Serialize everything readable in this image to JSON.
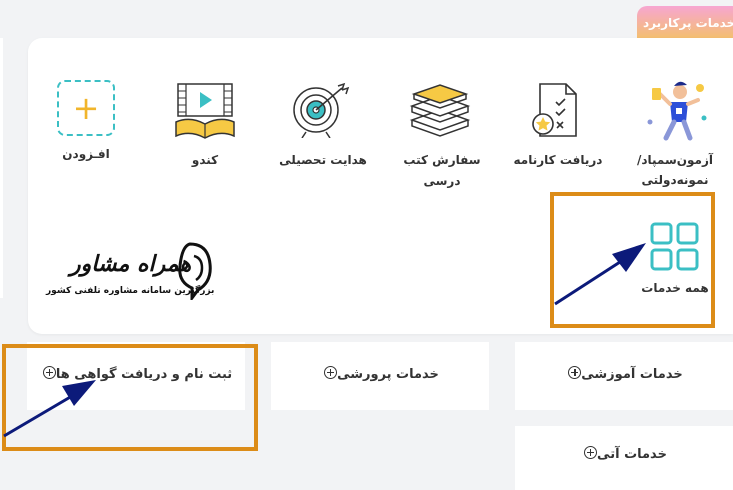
{
  "popular": {
    "badge": "خدمات پرکاربرد",
    "tiles": [
      {
        "label": "آزمون‌سمپاد/نمونه‌دولتی",
        "icon": "person-running-icon"
      },
      {
        "label": "دریافت کارنامه",
        "icon": "report-card-icon"
      },
      {
        "label": "سفارش کتب درسی",
        "label_line1": "سفارش کتب",
        "label_line2": "درسی",
        "icon": "book-stack-icon"
      },
      {
        "label": "هدایت تحصیلی",
        "icon": "target-arrow-icon"
      },
      {
        "label": "کندو",
        "icon": "video-book-icon"
      },
      {
        "label": "افـزودن",
        "icon": "plus-icon"
      }
    ],
    "all_services": {
      "label": "همه خدمات",
      "icon": "grid-icon"
    }
  },
  "watermark": {
    "title": "همراه مشاور",
    "subtitle": "بزرگترین سامانه مشاوره تلفنی کشور"
  },
  "services": {
    "education": "خدمات آموزشی",
    "development": "خدمات پرورشی",
    "registration": "ثبت نام و دریافت گواهی ها",
    "future": "خدمات آتی"
  },
  "colors": {
    "highlight": "#dc8c18",
    "arrow": "#0c1a7a",
    "teal": "#3bbfc4",
    "accent_yellow": "#f1b52b"
  }
}
